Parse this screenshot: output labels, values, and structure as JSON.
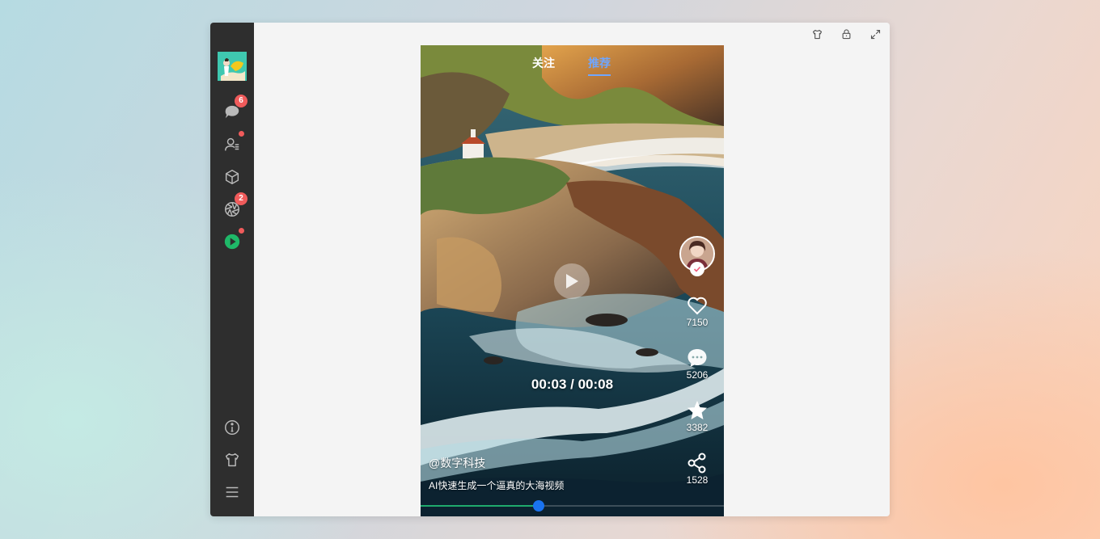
{
  "app": {
    "logo_icon": "app-logo-icon"
  },
  "sidebar": {
    "items": [
      {
        "name": "chat",
        "icon": "chat-bubble-icon",
        "badge": "6"
      },
      {
        "name": "contacts",
        "icon": "contacts-icon",
        "dot": true
      },
      {
        "name": "apps",
        "icon": "cube-icon"
      },
      {
        "name": "moments",
        "icon": "aperture-icon",
        "badge": "2"
      },
      {
        "name": "video",
        "icon": "play-circle-icon",
        "dot": true
      }
    ],
    "bottom_items": [
      {
        "name": "about",
        "icon": "info-icon"
      },
      {
        "name": "skin",
        "icon": "tshirt-icon"
      },
      {
        "name": "menu",
        "icon": "menu-icon"
      }
    ]
  },
  "window_controls": [
    {
      "name": "skin",
      "icon": "tshirt-icon"
    },
    {
      "name": "lock",
      "icon": "lock-icon"
    },
    {
      "name": "fullscreen",
      "icon": "expand-icon"
    }
  ],
  "video": {
    "tabs": [
      {
        "label": "关注",
        "active": false
      },
      {
        "label": "推荐",
        "active": true
      }
    ],
    "time_display": "00:03 / 00:08",
    "progress_percent": 39,
    "author": "@数字科技",
    "caption": "AI快速生成一个逼真的大海视频",
    "actions": {
      "likes": "7150",
      "comments": "5206",
      "favorites": "3382",
      "shares": "1528"
    }
  },
  "colors": {
    "sidebar_bg": "#2e2e2e",
    "badge": "#f05b5b",
    "active_tab": "#6fa6ff",
    "progress_fill": "#1faa6d",
    "progress_knob": "#1a73f0",
    "video_icon": "#1fb868"
  }
}
